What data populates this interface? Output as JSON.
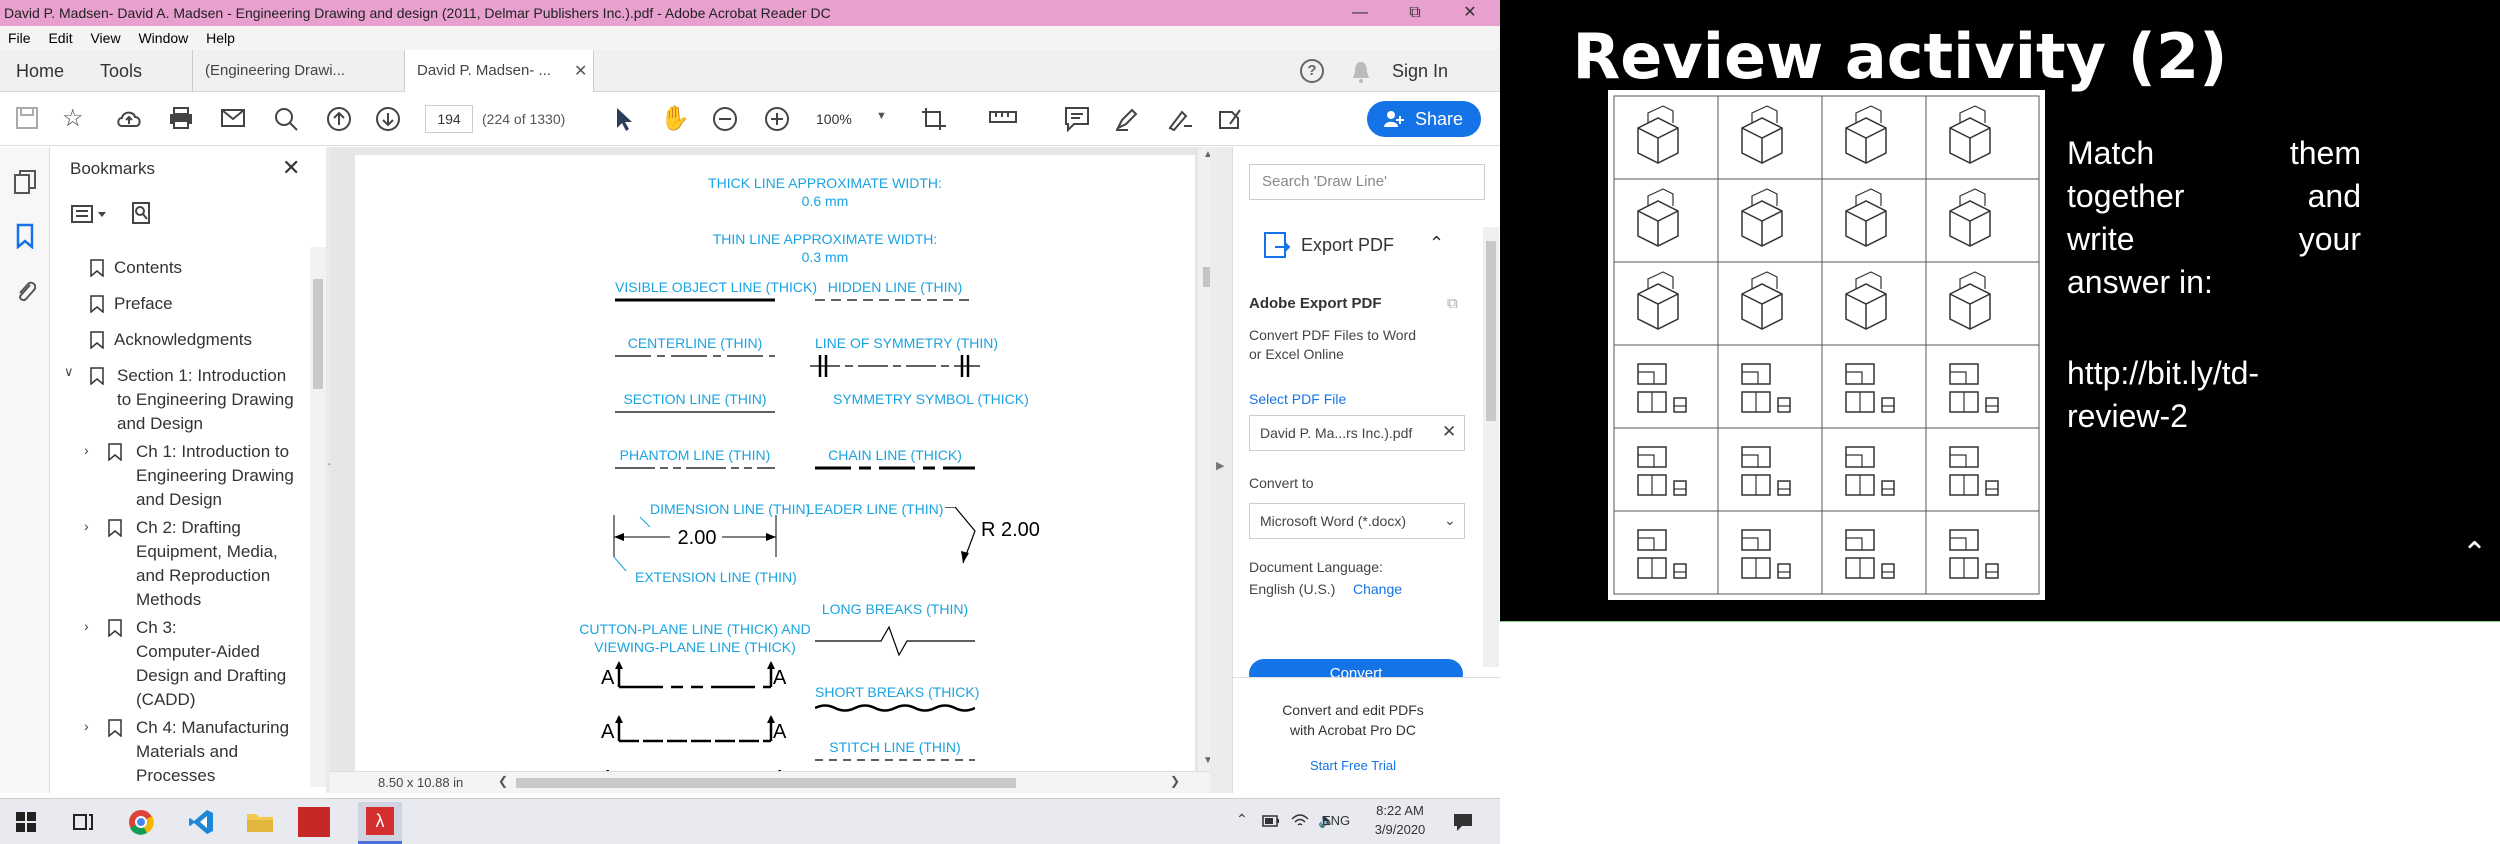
{
  "window": {
    "title": "David P. Madsen- David A. Madsen - Engineering Drawing and design (2011, Delmar Publishers Inc.).pdf - Adobe Acrobat Reader DC"
  },
  "menu": {
    "items": [
      "File",
      "Edit",
      "View",
      "Window",
      "Help"
    ]
  },
  "tabs": {
    "home": "Home",
    "tools": "Tools",
    "doc1": "(Engineering Drawi...",
    "doc2": "David P. Madsen- ...",
    "signin": "Sign In"
  },
  "toolbar": {
    "page_current": "194",
    "page_total": "(224 of 1330)",
    "zoom": "100%",
    "share": "Share"
  },
  "bookmarks": {
    "title": "Bookmarks",
    "items": [
      "Contents",
      "Preface",
      "Acknowledgments",
      "Section 1: Introduction",
      "to Engineering Drawing",
      "and Design",
      "Ch 1: Introduction to",
      "Engineering Drawing",
      "and Design",
      "Ch 2: Drafting",
      "Equipment, Media,",
      "and Reproduction",
      "Methods",
      "Ch 3:",
      "Computer-Aided",
      "Design and Drafting",
      "(CADD)",
      "Ch 4: Manufacturing",
      "Materials and",
      "Processes"
    ]
  },
  "page": {
    "thick_title": "THICK LINE APPROXIMATE WIDTH:",
    "thick_value": "0.6 mm",
    "thin_title": "THIN LINE APPROXIMATE WIDTH:",
    "thin_value": "0.3 mm",
    "visible": "VISIBLE OBJECT LINE (THICK)",
    "hidden": "HIDDEN LINE (THIN)",
    "center": "CENTERLINE (THIN)",
    "symmetry": "LINE OF SYMMETRY (THIN)",
    "symmetry_symbol": "SYMMETRY SYMBOL (THICK)",
    "section": "SECTION LINE (THIN)",
    "phantom": "PHANTOM LINE (THIN)",
    "chain": "CHAIN LINE (THICK)",
    "dimension": "DIMENSION LINE (THIN)",
    "dim_value": "2.00",
    "extension": "EXTENSION LINE (THIN)",
    "leader": "LEADER LINE (THIN)",
    "radius": "R 2.00",
    "cutting1": "CUTTON-PLANE LINE (THICK) AND",
    "cutting2": "VIEWING-PLANE LINE (THICK)",
    "long_breaks": "LONG BREAKS (THIN)",
    "short_breaks": "SHORT BREAKS (THICK)",
    "stitch": "STITCH LINE (THIN)",
    "a": "A",
    "size": "8.50 x 10.88 in"
  },
  "rightpane": {
    "search_placeholder": "Search 'Draw Line'",
    "export_title": "Export PDF",
    "adobe_export": "Adobe Export PDF",
    "convert_desc1": "Convert PDF Files to Word",
    "convert_desc2": "or Excel Online",
    "select_pdf": "Select PDF File",
    "file_name": "David P. Ma...rs Inc.).pdf",
    "convert_to": "Convert to",
    "format": "Microsoft Word (*.docx)",
    "doc_lang": "Document Language:",
    "lang": "English (U.S.)",
    "change": "Change",
    "convert_btn": "Convert",
    "promo1": "Convert and edit PDFs",
    "promo2": "with Acrobat Pro DC",
    "trial": "Start Free Trial"
  },
  "taskbar": {
    "lang": "ENG",
    "time": "8:22 AM",
    "date": "3/9/2020"
  },
  "slide": {
    "title": "Review activity (2)",
    "line1": "Match",
    "line1b": "them",
    "line2": "together",
    "line2b": "and",
    "line3": "write",
    "line3b": "your",
    "line4": "answer in:",
    "url1": "http://bit.ly/td-",
    "url2": "review-2"
  },
  "colors": {
    "accent": "#1473e6",
    "titlebar": "#e8a0cf",
    "label": "#1aa3e0"
  }
}
